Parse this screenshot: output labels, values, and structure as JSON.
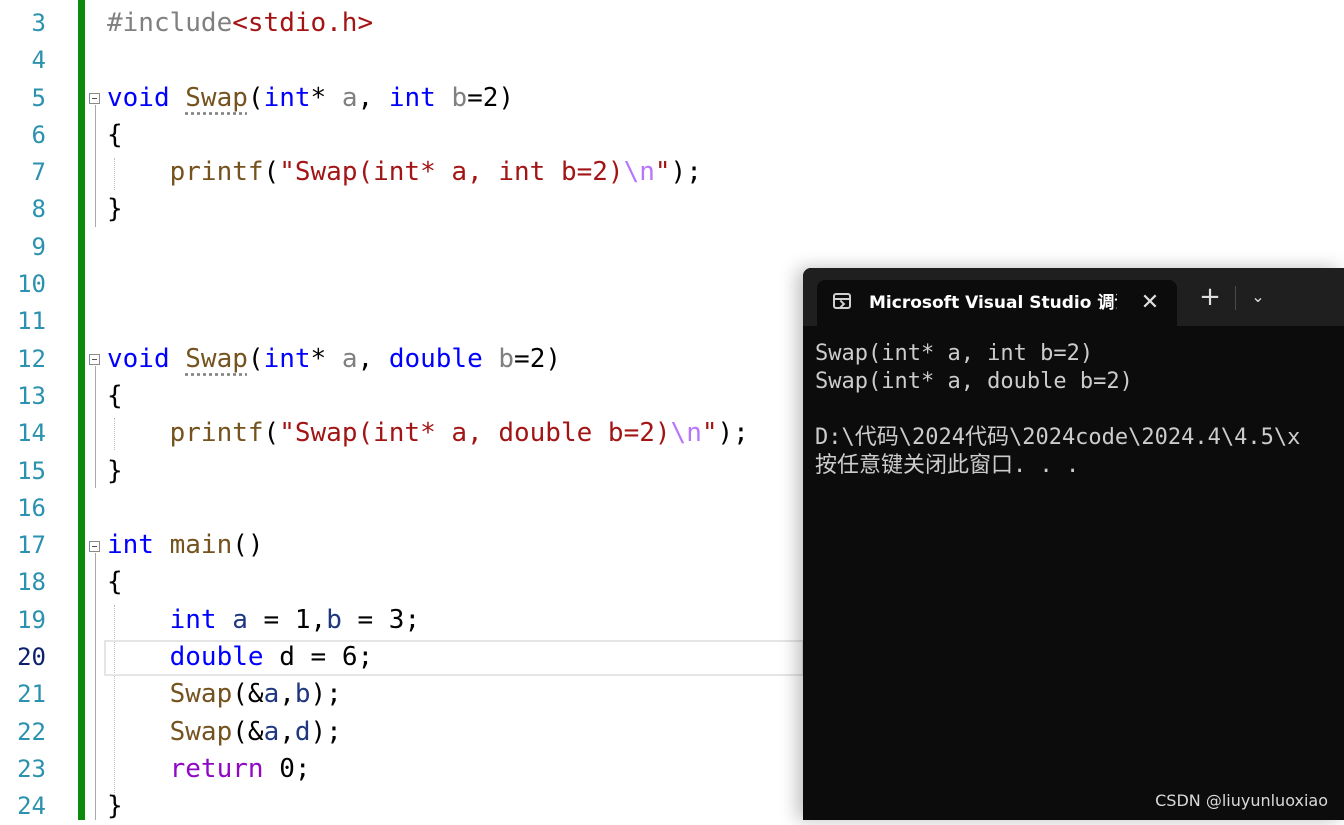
{
  "editor": {
    "line_numbers": [
      "3",
      "4",
      "5",
      "6",
      "7",
      "8",
      "9",
      "10",
      "11",
      "12",
      "13",
      "14",
      "15",
      "16",
      "17",
      "18",
      "19",
      "20",
      "21",
      "22",
      "23",
      "24"
    ],
    "current_line": "20",
    "code": {
      "l3": {
        "pp": "#include",
        "hdr": "<stdio.h>"
      },
      "l5": {
        "void": "void",
        "name": "Swap",
        "open": "(",
        "int1": "int",
        "star": "* ",
        "a": "a",
        "comma": ", ",
        "int2": "int",
        "sp": " ",
        "b": "b",
        "rest": "=2)"
      },
      "l6": {
        "brace": "{"
      },
      "l7": {
        "fn": "printf",
        "open": "(",
        "str": "\"Swap(int* a, int b=2)",
        "esc": "\\n",
        "strend": "\"",
        "close": ");"
      },
      "l8": {
        "brace": "}"
      },
      "l12": {
        "void": "void",
        "name": "Swap",
        "open": "(",
        "int1": "int",
        "star": "* ",
        "a": "a",
        "comma": ", ",
        "dbl": "double",
        "sp": " ",
        "b": "b",
        "rest": "=2)"
      },
      "l13": {
        "brace": "{"
      },
      "l14": {
        "fn": "printf",
        "open": "(",
        "str": "\"Swap(int* a, double b=2)",
        "esc": "\\n",
        "strend": "\"",
        "close": ");"
      },
      "l15": {
        "brace": "}"
      },
      "l17": {
        "int": "int",
        "sp": " ",
        "name": "main",
        "rest": "()"
      },
      "l18": {
        "brace": "{"
      },
      "l19": {
        "int": "int",
        "sp": " ",
        "a": "a",
        "mid": " = 1,",
        "b": "b",
        "rest": " = 3;"
      },
      "l20": {
        "dbl": "double",
        "rest": " d = 6;"
      },
      "l21": {
        "fn": "Swap",
        "open": "(&",
        "a": "a",
        "comma": ",",
        "b": "b",
        "close": ");"
      },
      "l22": {
        "fn": "Swap",
        "open": "(&",
        "a": "a",
        "comma": ",",
        "d": "d",
        "close": ");"
      },
      "l23": {
        "ret": "return",
        "rest": " 0;"
      },
      "l24": {
        "brace": "}"
      }
    }
  },
  "terminal": {
    "tab_title": "Microsoft Visual Studio 调试控制台",
    "close_glyph": "✕",
    "new_tab_glyph": "+",
    "dropdown_glyph": "⌄",
    "output": [
      "Swap(int* a, int b=2)",
      "Swap(int* a, double b=2)",
      "",
      "D:\\代码\\2024代码\\2024code\\2024.4\\4.5\\x",
      "按任意键关闭此窗口. . ."
    ]
  },
  "watermark": "CSDN @liuyunluoxiao"
}
